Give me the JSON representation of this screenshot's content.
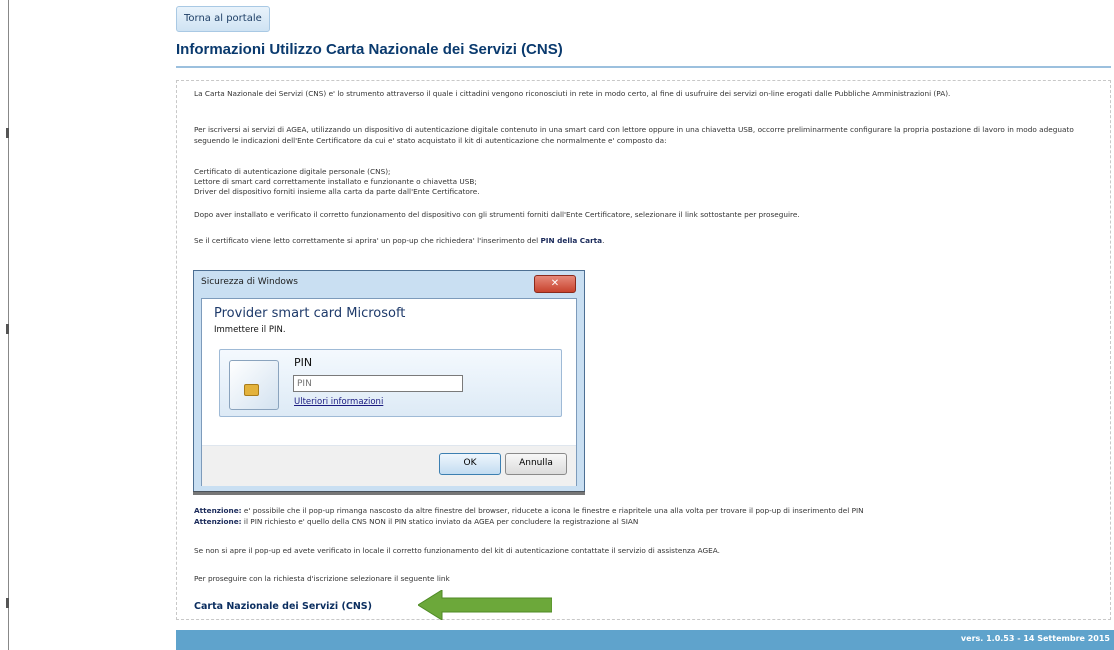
{
  "nav": {
    "back_label": "Torna al portale"
  },
  "page": {
    "title": "Informazioni Utilizzo Carta Nazionale dei Servizi (CNS)"
  },
  "content": {
    "intro": "La Carta Nazionale dei Servizi (CNS) e' lo strumento attraverso il quale i cittadini vengono riconosciuti in rete in modo certo, al fine di usufruire dei servizi on-line erogati dalle Pubbliche Amministrazioni (PA).",
    "subscribe": "Per iscriversi ai servizi di AGEA, utilizzando un dispositivo di autenticazione digitale contenuto in una smart card con lettore oppure in una chiavetta USB, occorre preliminarmente configurare la propria postazione di lavoro in modo adeguato seguendo le indicazioni dell'Ente Certificatore da cui e' stato acquistato il kit di autenticazione che normalmente e' composto da:",
    "kit_items": [
      "Certificato di autenticazione digitale personale (CNS);",
      "Lettore di smart card correttamente installato e funzionante o chiavetta USB;",
      "Driver del dispositivo forniti insieme alla carta da parte dall'Ente Certificatore."
    ],
    "after_install": "Dopo aver installato e verificato il corretto funzionamento del dispositivo con gli strumenti forniti dall'Ente Certificatore, selezionare il link sottostante per proseguire.",
    "popup_note_prefix": "Se il certificato viene letto correttamente si aprira' un pop-up che richiedera' l'inserimento del ",
    "popup_note_bold": "PIN della Carta",
    "popup_note_suffix": ".",
    "warning_label": "Attenzione:",
    "warning_1": " e' possibile che il pop-up rimanga nascosto da altre finestre del browser, riducete a icona le finestre e riapritele una alla volta per trovare il pop-up di inserimento del PIN",
    "warning_2": " il PIN richiesto e' quello della CNS NON il PIN statico inviato da AGEA per concludere la registrazione al SIAN",
    "no_popup": "Se non si apre il pop-up ed avete verificato in locale il corretto funzionamento del kit di autenticazione contattate il servizio di assistenza AGEA.",
    "proceed": "Per proseguire con la richiesta d'iscrizione selezionare il seguente link",
    "cns_link": "Carta Nazionale dei Servizi (CNS)"
  },
  "dialog": {
    "window_title": "Sicurezza di Windows",
    "close_glyph": "✕",
    "heading": "Provider smart card Microsoft",
    "subheading": "Immettere il PIN.",
    "pin_label": "PIN",
    "pin_placeholder": "PIN",
    "more_info": "Ulteriori informazioni",
    "ok_label": "OK",
    "cancel_label": "Annulla"
  },
  "footer": {
    "version": "vers. 1.0.53 - 14 Settembre 2015"
  },
  "colors": {
    "accent": "#5fa3cc",
    "title": "#0a3a6e",
    "arrow": "#6ca83a"
  },
  "icons": {
    "card": "smart-card-icon",
    "arrow": "arrow-left-icon",
    "close": "close-icon"
  }
}
